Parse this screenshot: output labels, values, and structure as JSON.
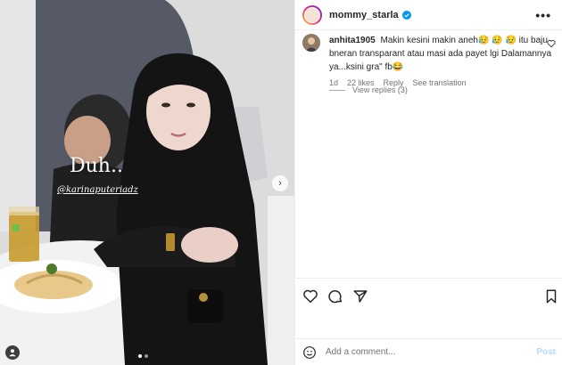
{
  "photo": {
    "overlay_text": "Duh..",
    "overlay_tag": "@karinaputeriadz"
  },
  "post": {
    "username": "mommy_starla",
    "more_label": "•••"
  },
  "comment": {
    "username": "anhita1905",
    "text": "Makin kesini makin aneh😥 😥 😥 itu baju bneran transparant atau masi ada payet lgi Dalamannya ya...ksini gra\" fb😂",
    "time": "1d",
    "likes": "22 likes",
    "reply_label": "Reply",
    "translation_label": "See translation",
    "view_replies": "View replies (3)"
  },
  "add_comment": {
    "placeholder": "Add a comment...",
    "post_label": "Post"
  },
  "colors": {
    "verified": "#0095f6",
    "post_disabled": "#b3dbff"
  }
}
